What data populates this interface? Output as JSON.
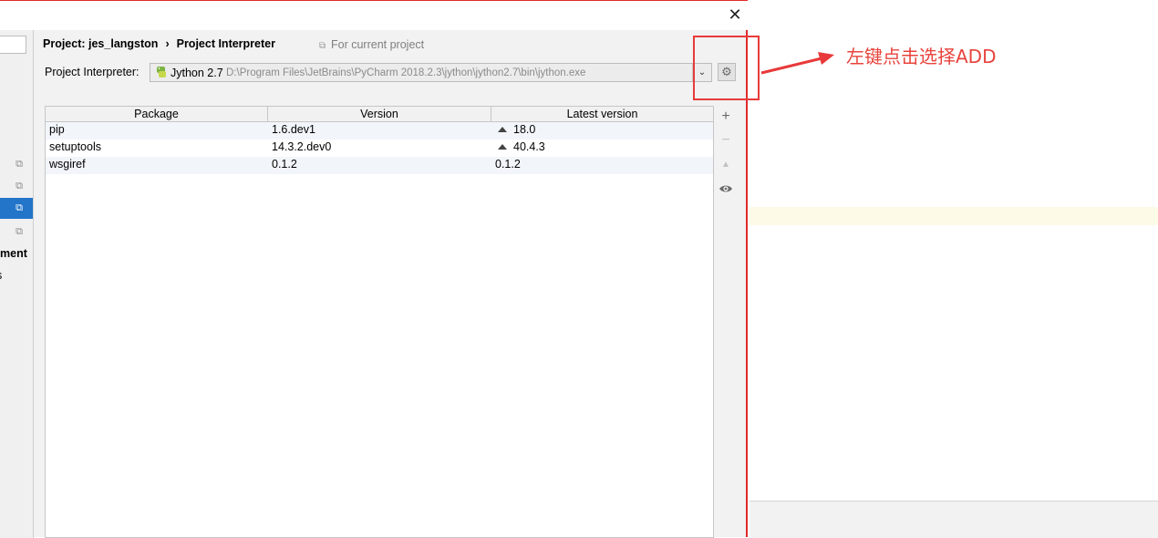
{
  "dialog": {
    "breadcrumb": {
      "project": "Project: jes_langston",
      "separator": "›",
      "page": "Project Interpreter"
    },
    "scope_label": "For current project",
    "close_glyph": "✕"
  },
  "left_panel": {
    "cut_text_1": "ment",
    "cut_text_2": "s"
  },
  "interpreter": {
    "label": "Project Interpreter:",
    "name": "Jython 2.7",
    "path": "D:\\Program Files\\JetBrains\\PyCharm 2018.2.3\\jython\\jython2.7\\bin\\jython.exe"
  },
  "table": {
    "columns": [
      "Package",
      "Version",
      "Latest version"
    ],
    "rows": [
      {
        "package": "pip",
        "version": "1.6.dev1",
        "latest": "18.0",
        "upgrade": true
      },
      {
        "package": "setuptools",
        "version": "14.3.2.dev0",
        "latest": "40.4.3",
        "upgrade": true
      },
      {
        "package": "wsgiref",
        "version": "0.1.2",
        "latest": "0.1.2",
        "upgrade": false
      }
    ]
  },
  "toolbar": {
    "add": "+",
    "remove": "−",
    "upgrade": "▲",
    "show": "👁"
  },
  "annotation": {
    "text": "左键点击选择ADD",
    "color": "#e8433c"
  },
  "colors": {
    "accent": "#2375c9",
    "annotation_red": "#e83a3a"
  }
}
